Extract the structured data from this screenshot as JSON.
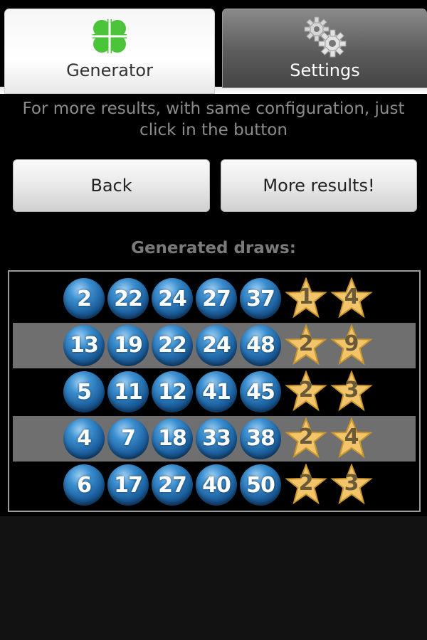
{
  "tabs": [
    {
      "label": "Generator",
      "icon": "clover-icon",
      "active": true
    },
    {
      "label": "Settings",
      "icon": "gears-icon",
      "active": false
    }
  ],
  "info_text": "For more results, with same configuration, just click in the button",
  "buttons": {
    "back": "Back",
    "more": "More results!"
  },
  "draws_title": "Generated draws:",
  "draws": [
    {
      "numbers": [
        "2",
        "22",
        "24",
        "27",
        "37"
      ],
      "stars": [
        "1",
        "4"
      ]
    },
    {
      "numbers": [
        "13",
        "19",
        "22",
        "24",
        "48"
      ],
      "stars": [
        "2",
        "9"
      ]
    },
    {
      "numbers": [
        "5",
        "11",
        "12",
        "41",
        "45"
      ],
      "stars": [
        "2",
        "3"
      ]
    },
    {
      "numbers": [
        "4",
        "7",
        "18",
        "33",
        "38"
      ],
      "stars": [
        "2",
        "4"
      ]
    },
    {
      "numbers": [
        "6",
        "17",
        "27",
        "40",
        "50"
      ],
      "stars": [
        "2",
        "3"
      ]
    }
  ],
  "colors": {
    "ball": "#1b5e9c",
    "star": "#f2c56b",
    "shaded_row": "#6f6f6f"
  }
}
